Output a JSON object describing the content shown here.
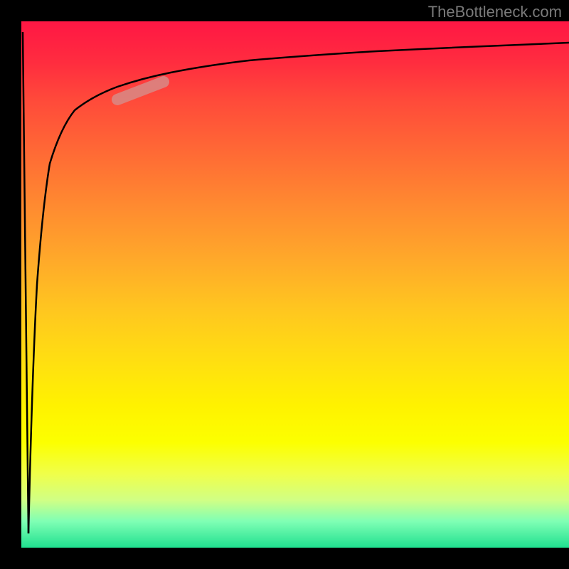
{
  "watermark": "TheBottleneck.com",
  "chart_data": {
    "type": "line",
    "title": "",
    "xlabel": "",
    "ylabel": "",
    "xlim": [
      0,
      100
    ],
    "ylim": [
      0,
      100
    ],
    "grid": false,
    "legend": false,
    "background_gradient": {
      "top": "#ff1744",
      "middle": "#ffe000",
      "bottom": "#20e090"
    },
    "series": [
      {
        "name": "bottleneck-curve",
        "description": "Steep spike down then logarithmic-style rise to plateau near top",
        "x": [
          0,
          1.5,
          3,
          4,
          5,
          6,
          8,
          10,
          13,
          16,
          20,
          25,
          30,
          40,
          50,
          60,
          75,
          90,
          100
        ],
        "y": [
          98,
          5,
          50,
          68,
          76,
          80,
          84,
          86,
          88,
          89.5,
          90.5,
          91.5,
          92.3,
          93.2,
          93.8,
          94.3,
          94.8,
          95.2,
          95.5
        ]
      }
    ],
    "highlight": {
      "note": "salmon-colored segment overlay on curve",
      "x_range": [
        18,
        26
      ],
      "y_range": [
        85,
        88
      ]
    }
  }
}
